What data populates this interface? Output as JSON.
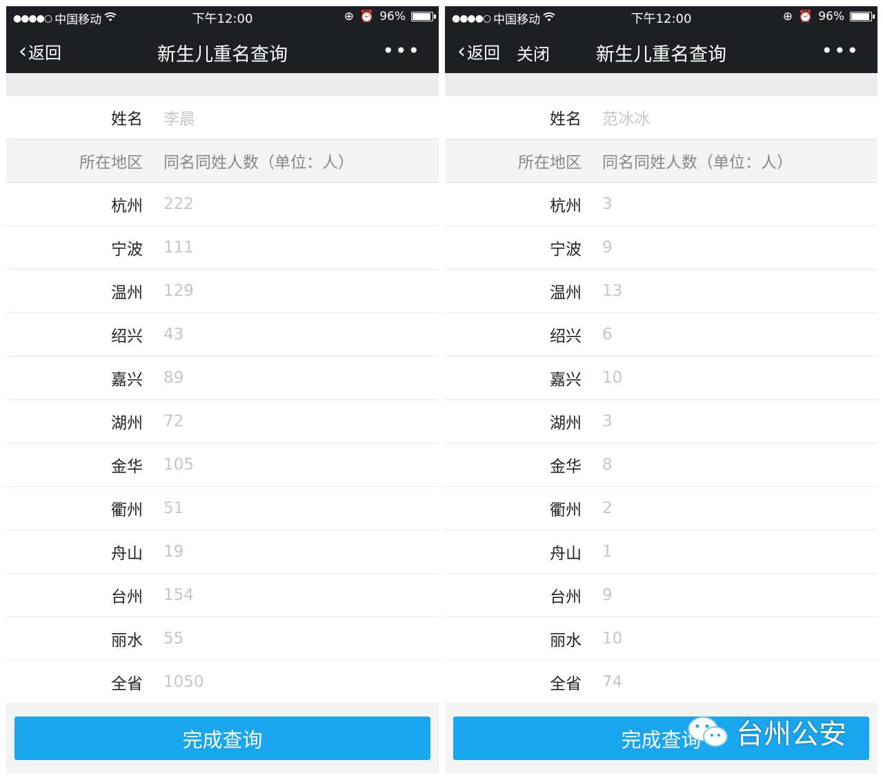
{
  "status": {
    "carrier": "中国移动",
    "time": "下午12:00",
    "battery": "96%"
  },
  "nav": {
    "back": "返回",
    "close": "关闭",
    "title": "新生儿重名查询",
    "more": "•••"
  },
  "header": {
    "region": "所在地区",
    "count": "同名同姓人数（单位：人）"
  },
  "name_label": "姓名",
  "submit": "完成查询",
  "watermark": "台州公安",
  "left": {
    "name": "李晨",
    "rows": [
      {
        "region": "杭州",
        "count": "222"
      },
      {
        "region": "宁波",
        "count": "111"
      },
      {
        "region": "温州",
        "count": "129"
      },
      {
        "region": "绍兴",
        "count": "43"
      },
      {
        "region": "嘉兴",
        "count": "89"
      },
      {
        "region": "湖州",
        "count": "72"
      },
      {
        "region": "金华",
        "count": "105"
      },
      {
        "region": "衢州",
        "count": "51"
      },
      {
        "region": "舟山",
        "count": "19"
      },
      {
        "region": "台州",
        "count": "154"
      },
      {
        "region": "丽水",
        "count": "55"
      },
      {
        "region": "全省",
        "count": "1050"
      }
    ]
  },
  "right": {
    "name": "范冰冰",
    "rows": [
      {
        "region": "杭州",
        "count": "3"
      },
      {
        "region": "宁波",
        "count": "9"
      },
      {
        "region": "温州",
        "count": "13"
      },
      {
        "region": "绍兴",
        "count": "6"
      },
      {
        "region": "嘉兴",
        "count": "10"
      },
      {
        "region": "湖州",
        "count": "3"
      },
      {
        "region": "金华",
        "count": "8"
      },
      {
        "region": "衢州",
        "count": "2"
      },
      {
        "region": "舟山",
        "count": "1"
      },
      {
        "region": "台州",
        "count": "9"
      },
      {
        "region": "丽水",
        "count": "10"
      },
      {
        "region": "全省",
        "count": "74"
      }
    ]
  },
  "colors": {
    "nav_bg": "#1e1f23",
    "button": "#19a6ef",
    "value_text": "#c6c6c6"
  }
}
